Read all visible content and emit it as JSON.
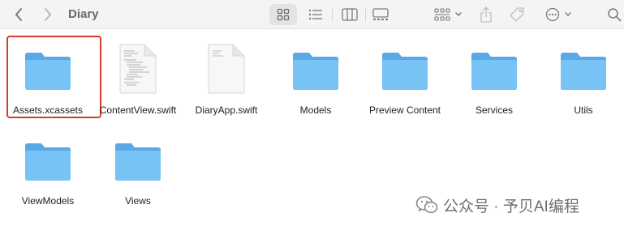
{
  "window": {
    "title": "Diary"
  },
  "toolbar": {
    "back_icon": "chevron-left-icon",
    "forward_icon": "chevron-right-icon",
    "view_modes": [
      "icon",
      "list",
      "columns",
      "gallery"
    ],
    "active_view": "icon"
  },
  "files": [
    {
      "name": "Assets.xcassets",
      "kind": "folder",
      "selected": true
    },
    {
      "name": "ContentView.swift",
      "kind": "swift-file",
      "selected": false
    },
    {
      "name": "DiaryApp.swift",
      "kind": "swift-file-blank",
      "selected": false
    },
    {
      "name": "Models",
      "kind": "folder",
      "selected": false
    },
    {
      "name": "Preview Content",
      "kind": "folder",
      "selected": false
    },
    {
      "name": "Services",
      "kind": "folder",
      "selected": false
    },
    {
      "name": "Utils",
      "kind": "folder",
      "selected": false
    },
    {
      "name": "ViewModels",
      "kind": "folder",
      "selected": false
    },
    {
      "name": "Views",
      "kind": "folder",
      "selected": false
    }
  ],
  "watermark": {
    "text": "公众号 · 予贝AI编程"
  },
  "colors": {
    "folder_front": "#78c3f5",
    "folder_back": "#5aa9e6",
    "selection_outline": "#d63a2f"
  }
}
